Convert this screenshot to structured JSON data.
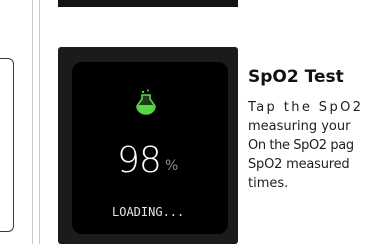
{
  "watch": {
    "icon": "flask-icon",
    "value": "98",
    "unit": "%",
    "status": "LOADING..."
  },
  "article": {
    "title": "SpO2 Test",
    "lines": [
      "Tap the SpO2",
      "measuring your",
      "On the SpO2 pag",
      "SpO2 measured",
      "times."
    ]
  },
  "colors": {
    "screen_bg": "#000000",
    "card_bg": "#1b1b1b",
    "flask_liquid": "#5bd64a"
  }
}
